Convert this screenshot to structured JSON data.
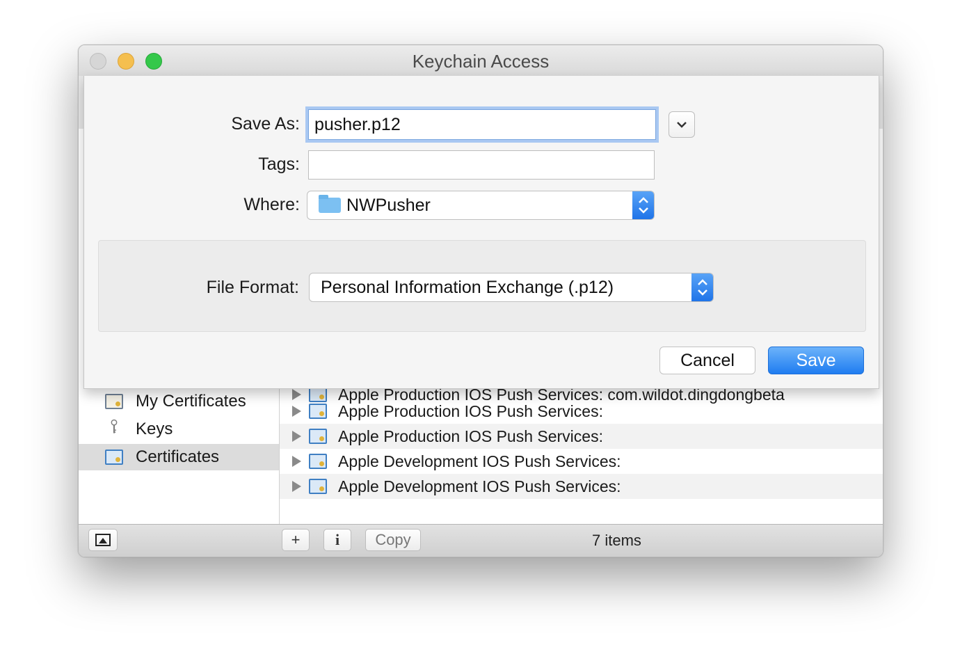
{
  "window": {
    "title": "Keychain Access"
  },
  "sidebar": {
    "items": [
      {
        "label": "My Certificates"
      },
      {
        "label": "Keys"
      },
      {
        "label": "Certificates"
      }
    ]
  },
  "list": {
    "partial_row": "Apple Production IOS Push Services: com.wildot.dingdongbeta",
    "rows": [
      {
        "label": "Apple Production IOS Push Services:"
      },
      {
        "label": "Apple Production IOS Push Services:"
      },
      {
        "label": "Apple Development IOS Push Services:"
      },
      {
        "label": "Apple Development IOS Push Services:"
      }
    ]
  },
  "bottombar": {
    "add_label": "+",
    "info_label": "i",
    "copy_label": "Copy",
    "count": "7 items"
  },
  "sheet": {
    "save_as_label": "Save As:",
    "save_as_value": "pusher.p12",
    "tags_label": "Tags:",
    "tags_value": "",
    "where_label": "Where:",
    "where_value": "NWPusher",
    "file_format_label": "File Format:",
    "file_format_value": "Personal Information Exchange (.p12)",
    "cancel_label": "Cancel",
    "save_label": "Save"
  },
  "colors": {
    "accent": "#1f7cf0",
    "focus_ring": "#a9c8f2"
  }
}
